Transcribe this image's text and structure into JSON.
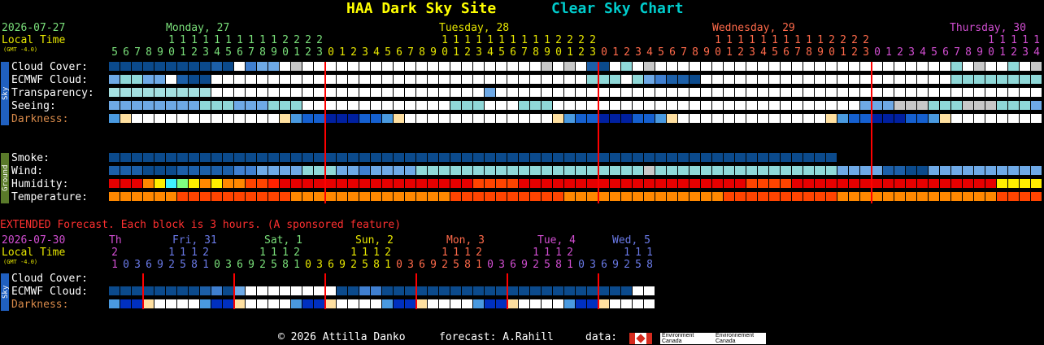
{
  "header": {
    "site_title": "HAA Dark Sky Site",
    "chart_title": "Clear Sky Chart",
    "date": "2026-07-27",
    "local_time": "Local Time",
    "gmt": "(GMT -4.0)",
    "days": [
      {
        "label": "Monday, 27",
        "color": "#7ae07a"
      },
      {
        "label": "Tuesday, 28",
        "color": "#e6e600"
      },
      {
        "label": "Wednesday, 29",
        "color": "#ff6a4a"
      },
      {
        "label": "Thursday, 30",
        "color": "#d24ed2"
      }
    ],
    "hours_tens": [
      " ",
      " ",
      " ",
      " ",
      " ",
      "1",
      "1",
      "1",
      "1",
      "1",
      "1",
      "1",
      "1",
      "1",
      "1",
      "2",
      "2",
      "2",
      "2"
    ],
    "hours_ones": "5678901234567890123"
  },
  "rows": {
    "cloud_cover": "Cloud Cover:",
    "ecmwf_cloud": "ECMWF Cloud:",
    "transparency": "Transparency:",
    "seeing": "Seeing:",
    "darkness": "Darkness:",
    "smoke": "Smoke:",
    "wind": "Wind:",
    "humidity": "Humidity:",
    "temperature": "Temperature:"
  },
  "side_tabs": {
    "sky": "Sky",
    "ground": "Ground"
  },
  "colors": {
    "title_yellow": "#ffff00",
    "title_cyan": "#00cccc",
    "date_green": "#7ae07a",
    "local_time_yellow": "#e6e600",
    "label_white": "#ffffff",
    "darkness_label": "#d88a4a",
    "extended_red": "#ff3030",
    "sky_tab": "#2060c0",
    "ground_tab": "#5a7a2a",
    "day_break_line": "#ff0000"
  },
  "extended": {
    "heading": "EXTENDED Forecast. Each block is 3 hours. (A sponsored feature)",
    "date": "2026-07-30",
    "local_time": "Local Time",
    "gmt": "(GMT -4.0)",
    "days": [
      {
        "label": "Th",
        "color": "#d24ed2"
      },
      {
        "label": "Fri, 31",
        "color": "#6a7ae8"
      },
      {
        "label": "Sat, 1",
        "color": "#7ae07a"
      },
      {
        "label": "Sun, 2",
        "color": "#e6e600"
      },
      {
        "label": "Mon, 3",
        "color": "#ff6a4a"
      },
      {
        "label": "Tue, 4",
        "color": "#d24ed2"
      },
      {
        "label": "Wed, 5",
        "color": "#6a7ae8"
      }
    ],
    "rows": {
      "cloud_cover": "Cloud Cover:",
      "ecmwf_cloud": "ECMWF Cloud:",
      "darkness": "Darkness:"
    }
  },
  "footer": {
    "copyright": "© 2026 Attilla Danko",
    "forecast": "forecast: A.Rahill",
    "data": "data:",
    "env_canada": "Environment Canada",
    "env_canada_fr": "Environnement Canada"
  }
}
